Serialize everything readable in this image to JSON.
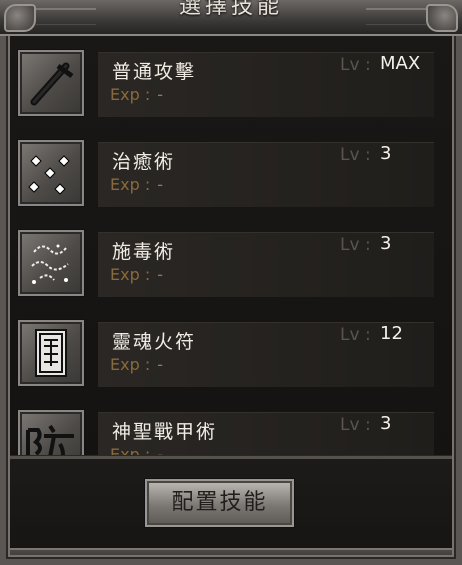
{
  "header": {
    "title": "選擇技能"
  },
  "skills": [
    {
      "name": "普通攻擊",
      "exp_label": "Exp",
      "exp_value": "-",
      "lv_label": "Lv",
      "lv_value": "MAX",
      "icon": "sword-icon"
    },
    {
      "name": "治癒術",
      "exp_label": "Exp",
      "exp_value": "-",
      "lv_label": "Lv",
      "lv_value": "3",
      "icon": "sparkle-diamonds-icon"
    },
    {
      "name": "施毒術",
      "exp_label": "Exp",
      "exp_value": "-",
      "lv_label": "Lv",
      "lv_value": "3",
      "icon": "poison-swirl-icon"
    },
    {
      "name": "靈魂火符",
      "exp_label": "Exp",
      "exp_value": "-",
      "lv_label": "Lv",
      "lv_value": "12",
      "icon": "talisman-icon"
    },
    {
      "name": "神聖戰甲術",
      "exp_label": "Exp",
      "exp_value": "-",
      "lv_label": "Lv",
      "lv_value": "3",
      "icon": "defense-rune-icon"
    }
  ],
  "footer": {
    "configure_label": "配置技能"
  },
  "colors": {
    "exp_text": "#8a6a3a",
    "lv_label": "#5a5450",
    "name_text": "#f0ece4"
  }
}
